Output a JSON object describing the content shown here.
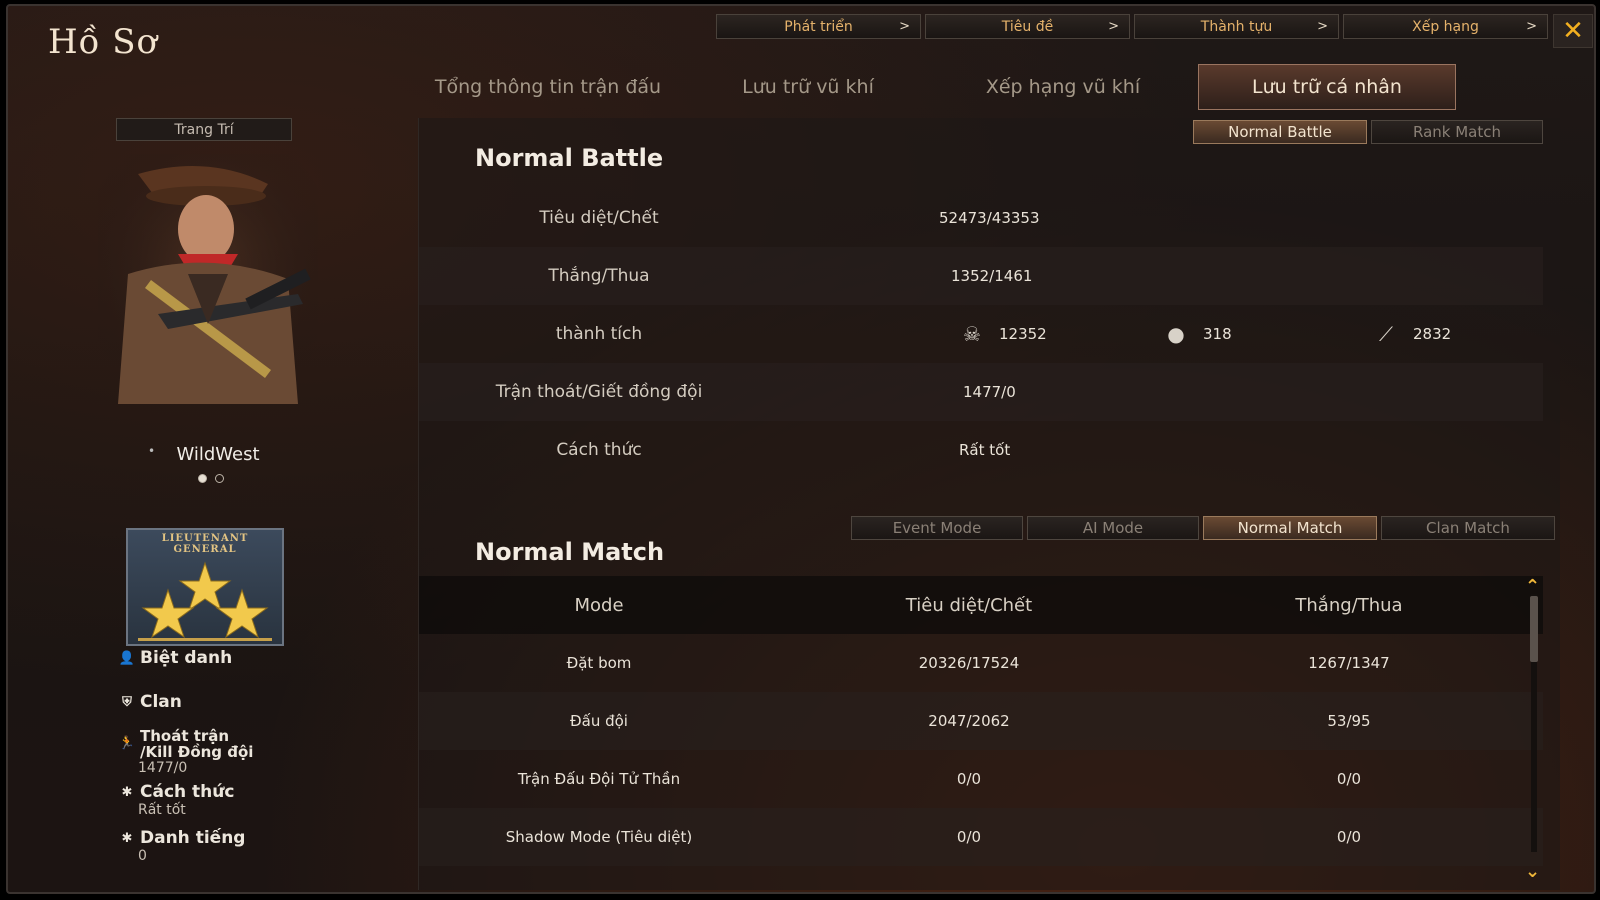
{
  "window": {
    "title": "Hồ Sơ"
  },
  "top_nav": [
    {
      "label": "Phát triển",
      "chevron": ">"
    },
    {
      "label": "Tiêu đề",
      "chevron": ">"
    },
    {
      "label": "Thành tựu",
      "chevron": ">"
    },
    {
      "label": "Xếp hạng",
      "chevron": ">"
    }
  ],
  "close_icon": "✕",
  "main_tabs": [
    {
      "label": "Tổng thông tin trận đấu",
      "active": false
    },
    {
      "label": "Lưu trữ vũ khí",
      "active": false
    },
    {
      "label": "Xếp hạng vũ khí",
      "active": false
    },
    {
      "label": "Lưu trữ cá nhân",
      "active": true
    }
  ],
  "profile": {
    "decor_button": "Trang Trí",
    "character_name": "WildWest",
    "pager_active_index": 0,
    "rank_badge_text": "LIEUTENANT GENERAL",
    "rank_stars": 3,
    "nickname_label": "Biệt danh",
    "clan_label": "Clan",
    "escape_label_line1": "Thoát trận",
    "escape_label_line2": "/Kill Đồng đội",
    "escape_value": "1477/0",
    "manner_label": "Cách thức",
    "manner_value": "Rất tốt",
    "fame_label": "Danh tiếng",
    "fame_value": "0"
  },
  "battle_tabs": [
    {
      "label": "Normal Battle",
      "active": true
    },
    {
      "label": "Rank Match",
      "active": false
    }
  ],
  "normal_battle": {
    "title": "Normal Battle",
    "kill_death_label": "Tiêu diệt/Chết",
    "kill_death_value": "52473/43353",
    "win_loss_label": "Thắng/Thua",
    "win_loss_value": "1352/1461",
    "achievement_label": "thành tích",
    "headshots": "12352",
    "grenade_kills": "318",
    "knife_kills": "2832",
    "escape_label": "Trận thoát/Giết đồng đội",
    "escape_value": "1477/0",
    "manner_label": "Cách thức",
    "manner_value": "Rất tốt"
  },
  "match_tabs": [
    {
      "label": "Event Mode",
      "active": false
    },
    {
      "label": "AI Mode",
      "active": false
    },
    {
      "label": "Normal Match",
      "active": true
    },
    {
      "label": "Clan Match",
      "active": false
    }
  ],
  "normal_match": {
    "title": "Normal Match",
    "columns": [
      "Mode",
      "Tiêu diệt/Chết",
      "Thắng/Thua"
    ],
    "rows": [
      [
        "Đặt bom",
        "20326/17524",
        "1267/1347"
      ],
      [
        "Đấu đội",
        "2047/2062",
        "53/95"
      ],
      [
        "Trận Đấu Đội Tử Thần",
        "0/0",
        "0/0"
      ],
      [
        "Shadow Mode (Tiêu diệt)",
        "0/0",
        "0/0"
      ]
    ]
  }
}
